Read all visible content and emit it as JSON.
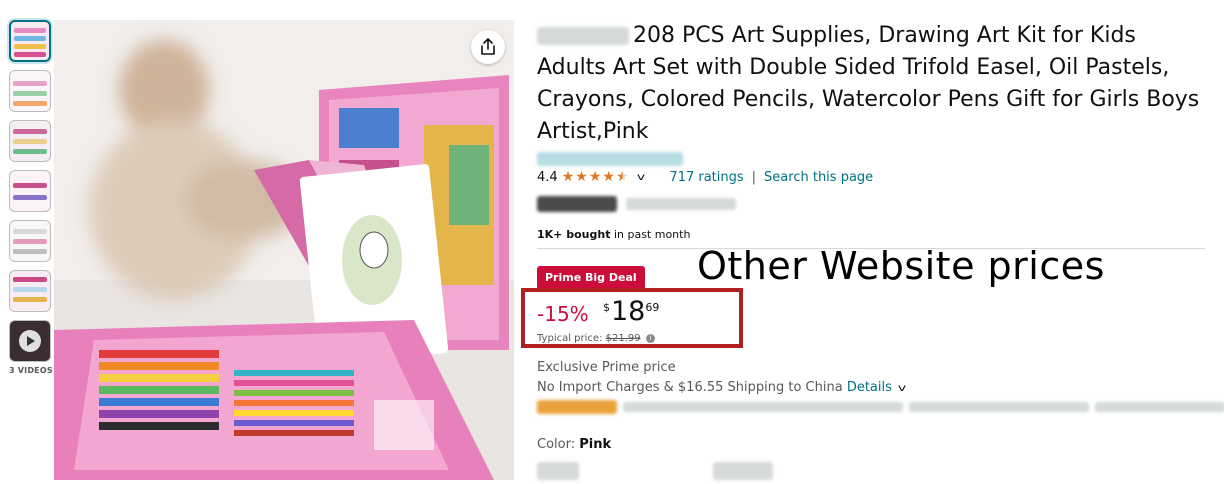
{
  "thumbnails": {
    "items": [
      "thumbnail-1",
      "thumbnail-2",
      "thumbnail-3",
      "thumbnail-4",
      "thumbnail-5",
      "thumbnail-6"
    ],
    "videos_label": "3 VIDEOS"
  },
  "product": {
    "title": "208 PCS Art Supplies, Drawing Art Kit for Kids Adults Art Set with Double Sided Trifold Easel, Oil Pastels, Crayons, Colored Pencils, Watercolor Pens Gift for Girls Boys Artist,Pink"
  },
  "rating": {
    "value": "4.4",
    "stars": 4.5,
    "count_text": "717 ratings",
    "separator": "|",
    "search_link": "Search this page"
  },
  "social_proof": {
    "bought_bold": "1K+ bought",
    "bought_rest": " in past month"
  },
  "deal": {
    "badge": "Prime Big Deal",
    "overlay_annotation": "Other Website prices",
    "discount": "-15%",
    "currency": "$",
    "price_whole": "18",
    "price_fraction": "69",
    "typical_label": "Typical price: ",
    "typical_value": "$21.99"
  },
  "delivery": {
    "exclusive": "Exclusive Prime price",
    "shipping_text": "No Import Charges & $16.55 Shipping to China ",
    "details_link": "Details"
  },
  "variant": {
    "color_label": "Color: ",
    "color_value": "Pink"
  },
  "colors": {
    "link": "#007185",
    "deal_red": "#cc0c39",
    "star": "#de7921",
    "annotation_box": "#b12020"
  }
}
